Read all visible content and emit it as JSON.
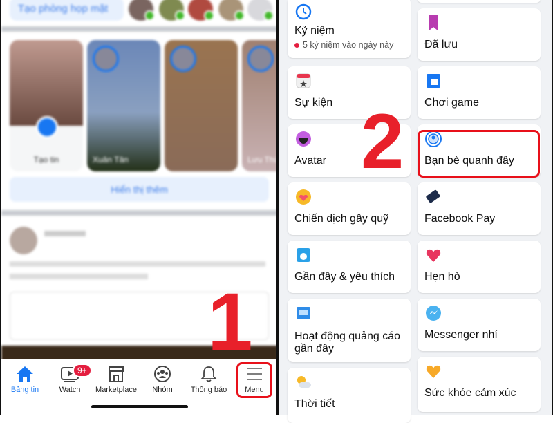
{
  "left": {
    "meet_button": "Tạo phòng họp mặt",
    "stories": [
      {
        "label": "Tạo tin"
      },
      {
        "label": "Xuân Tân"
      },
      {
        "label": ""
      },
      {
        "label": "Lưu Thú"
      }
    ],
    "show_more": "Hiển thị thêm",
    "step_number": "1",
    "nav": [
      {
        "label": "Bảng tin",
        "icon": "home-icon",
        "active": true
      },
      {
        "label": "Watch",
        "icon": "video-icon",
        "badge": "9+"
      },
      {
        "label": "Marketplace",
        "icon": "store-icon"
      },
      {
        "label": "Nhóm",
        "icon": "groups-icon"
      },
      {
        "label": "Thông báo",
        "icon": "bell-icon"
      },
      {
        "label": "Menu",
        "icon": "menu-icon",
        "highlighted": true
      }
    ]
  },
  "right": {
    "step_number": "2",
    "cards": [
      {
        "label": "Kỷ niệm",
        "sub": "5 kỷ niệm vào ngày này",
        "icon": "memories-icon"
      },
      {
        "label": "Đã lưu",
        "icon": "saved-icon"
      },
      {
        "label": "Sự kiện",
        "icon": "events-icon"
      },
      {
        "label": "Chơi game",
        "icon": "gaming-icon"
      },
      {
        "label": "Avatar",
        "icon": "avatar-icon"
      },
      {
        "label": "Bạn bè quanh đây",
        "icon": "nearby-friends-icon",
        "highlighted": true
      },
      {
        "label": "Chiến dịch gây quỹ",
        "icon": "fundraiser-icon"
      },
      {
        "label": "Facebook Pay",
        "icon": "facebook-pay-icon"
      },
      {
        "label": "Gần đây & yêu thích",
        "icon": "recent-favorites-icon"
      },
      {
        "label": "Hẹn hò",
        "icon": "dating-icon"
      },
      {
        "label": "Hoạt động quảng cáo gần đây",
        "icon": "ad-activity-icon"
      },
      {
        "label": "Messenger nhí",
        "icon": "messenger-kids-icon"
      },
      {
        "label": "Thời tiết",
        "icon": "weather-icon"
      },
      {
        "label": "Sức khỏe cảm xúc",
        "icon": "emotional-health-icon"
      }
    ]
  },
  "colors": {
    "accent": "#1877f2",
    "highlight": "#e8101a"
  }
}
